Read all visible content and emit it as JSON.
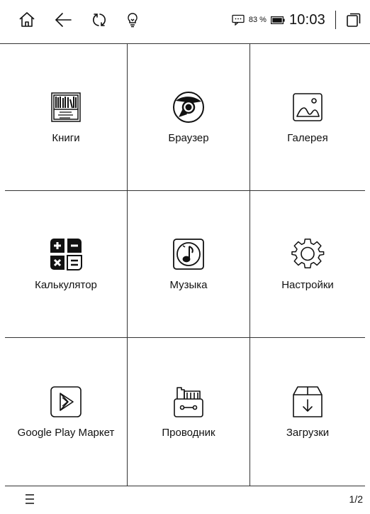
{
  "status_bar": {
    "battery_percent": "83 %",
    "time": "10:03",
    "icons": [
      "home-icon",
      "back-arrow-icon",
      "refresh-icon",
      "lightbulb-icon",
      "chat-icon",
      "battery-icon",
      "recent-apps-icon"
    ]
  },
  "apps": [
    {
      "label": "Книги",
      "icon": "books-icon"
    },
    {
      "label": "Браузер",
      "icon": "browser-icon"
    },
    {
      "label": "Галерея",
      "icon": "gallery-icon"
    },
    {
      "label": "Калькулятор",
      "icon": "calculator-icon"
    },
    {
      "label": "Музыка",
      "icon": "music-icon"
    },
    {
      "label": "Настройки",
      "icon": "settings-gear-icon"
    },
    {
      "label": "Google Play Маркет",
      "icon": "play-store-icon"
    },
    {
      "label": "Проводник",
      "icon": "file-explorer-icon"
    },
    {
      "label": "Загрузки",
      "icon": "downloads-icon"
    }
  ],
  "bottom_bar": {
    "page": "1/2",
    "menu_icon": "menu-icon"
  }
}
